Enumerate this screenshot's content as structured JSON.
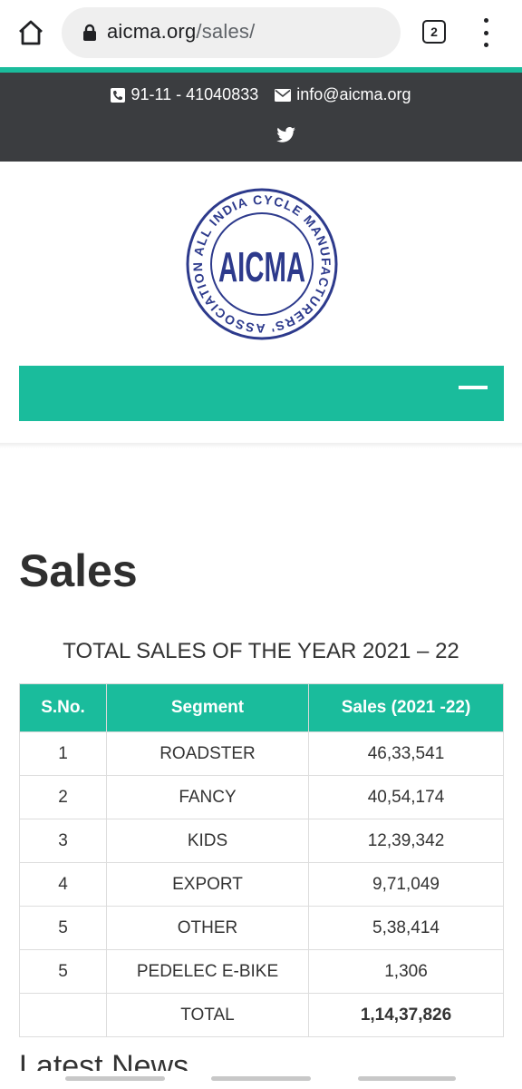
{
  "browser": {
    "url_host": "aicma.org",
    "url_path": "/sales/",
    "tab_count": "2"
  },
  "topbar": {
    "phone": "91-11 - 41040833",
    "email": "info@aicma.org"
  },
  "logo": {
    "text": "AICMA",
    "ring_text": "ALL INDIA CYCLE MANUFACTURERS' ASSOCIATION",
    "color": "#2d3a8c"
  },
  "colors": {
    "accent": "#1abc9c",
    "topbar": "#3b3d40"
  },
  "page": {
    "title": "Sales",
    "table_title": "TOTAL SALES OF THE YEAR 2021 – 22",
    "latest_heading": "Latest News"
  },
  "sales_table": {
    "headers": [
      "S.No.",
      "Segment",
      "Sales (2021 -22)"
    ],
    "rows": [
      [
        "1",
        "ROADSTER",
        "46,33,541"
      ],
      [
        "2",
        "FANCY",
        "40,54,174"
      ],
      [
        "3",
        "KIDS",
        "12,39,342"
      ],
      [
        "4",
        "EXPORT",
        "9,71,049"
      ],
      [
        "5",
        "OTHER",
        "5,38,414"
      ],
      [
        "5",
        "PEDELEC E-BIKE",
        "1,306"
      ],
      [
        "",
        "TOTAL",
        "1,14,37,826"
      ]
    ]
  }
}
